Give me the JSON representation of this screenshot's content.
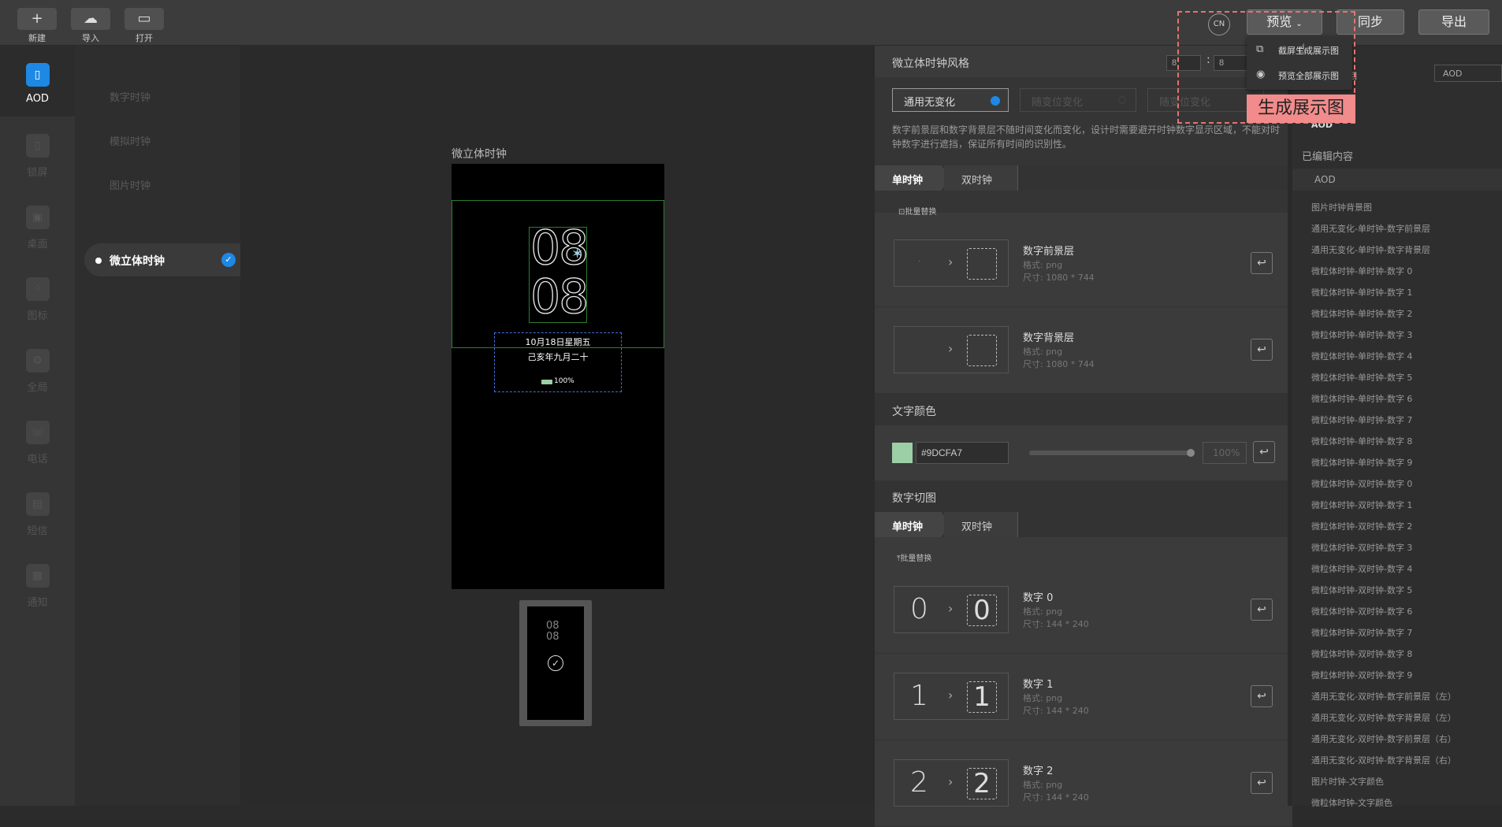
{
  "toolbar": {
    "new": "新建",
    "import": "导入",
    "open": "打开",
    "lang": "CN",
    "preview": "预览",
    "sync": "同步",
    "export": "导出"
  },
  "dropdown": {
    "item1": "截屏生成展示图",
    "item2": "预览全部展示图"
  },
  "annotation": "生成展示图",
  "nav": [
    {
      "label": "AOD",
      "icon": "phone-icon"
    },
    {
      "label": "锁屏",
      "icon": "lock-icon"
    },
    {
      "label": "桌面",
      "icon": "desktop-icon"
    },
    {
      "label": "图标",
      "icon": "grid-icon"
    },
    {
      "label": "全局",
      "icon": "gear-icon"
    },
    {
      "label": "电话",
      "icon": "phone-call-icon"
    },
    {
      "label": "短信",
      "icon": "message-icon"
    },
    {
      "label": "通知",
      "icon": "bell-icon"
    }
  ],
  "subnav": {
    "items": [
      "数字时钟",
      "模拟时钟",
      "图片时钟"
    ],
    "active": "微立体时钟"
  },
  "canvas": {
    "label": "微立体时钟",
    "digits_top": "08",
    "digits_bottom": "08",
    "date": "10月18日星期五",
    "lunar": "己亥年九月二十",
    "battery": "100%"
  },
  "panel": {
    "style_title": "微立体时钟风格",
    "hour": "8",
    "minute": "8",
    "colon": ":",
    "options": [
      "通用无变化",
      "随变位变化",
      "随变位变化"
    ],
    "description": "数字前景层和数字背景层不随时间变化而变化，设计时需要避开时钟数字显示区域，不能对时钟数字进行遮挡，保证所有时间的识别性。",
    "tab_single": "单时钟",
    "tab_double": "双时钟",
    "batch_replace": "批量替换",
    "layers": [
      {
        "title": "数字前景层",
        "format": "格式: png",
        "size": "尺寸: 1080 * 744"
      },
      {
        "title": "数字背景层",
        "format": "格式: png",
        "size": "尺寸: 1080 * 744"
      }
    ],
    "text_color_title": "文字颜色",
    "text_color": "#9DCFA7",
    "opacity": "100%",
    "slices_title": "数字切图",
    "digits": [
      {
        "glyph": "0",
        "title": "数字 0",
        "format": "格式: png",
        "size": "尺寸: 144 * 240"
      },
      {
        "glyph": "1",
        "title": "数字 1",
        "format": "格式: png",
        "size": "尺寸: 144 * 240"
      },
      {
        "glyph": "2",
        "title": "数字 2",
        "format": "格式: png",
        "size": "尺寸: 144 * 240"
      }
    ]
  },
  "right": {
    "header_label": "目",
    "select": "AOD",
    "aod_tag": "AOD",
    "edited_title": "已编辑内容",
    "group": "AOD",
    "items": [
      "图片时钟背景图",
      "通用无变化-单时钟-数字前景层",
      "通用无变化-单时钟-数字背景层",
      "微粒体时钟-单时钟-数字 0",
      "微粒体时钟-单时钟-数字 1",
      "微粒体时钟-单时钟-数字 2",
      "微粒体时钟-单时钟-数字 3",
      "微粒体时钟-单时钟-数字 4",
      "微粒体时钟-单时钟-数字 5",
      "微粒体时钟-单时钟-数字 6",
      "微粒体时钟-单时钟-数字 7",
      "微粒体时钟-单时钟-数字 8",
      "微粒体时钟-单时钟-数字 9",
      "微粒体时钟-双时钟-数字 0",
      "微粒体时钟-双时钟-数字 1",
      "微粒体时钟-双时钟-数字 2",
      "微粒体时钟-双时钟-数字 3",
      "微粒体时钟-双时钟-数字 4",
      "微粒体时钟-双时钟-数字 5",
      "微粒体时钟-双时钟-数字 6",
      "微粒体时钟-双时钟-数字 7",
      "微粒体时钟-双时钟-数字 8",
      "微粒体时钟-双时钟-数字 9",
      "通用无变化-双时钟-数字前景层（左）",
      "通用无变化-双时钟-数字背景层（左）",
      "通用无变化-双时钟-数字前景层（右）",
      "通用无变化-双时钟-数字背景层（右）",
      "图片时钟-文字颜色",
      "微粒体时钟-文字颜色"
    ]
  }
}
